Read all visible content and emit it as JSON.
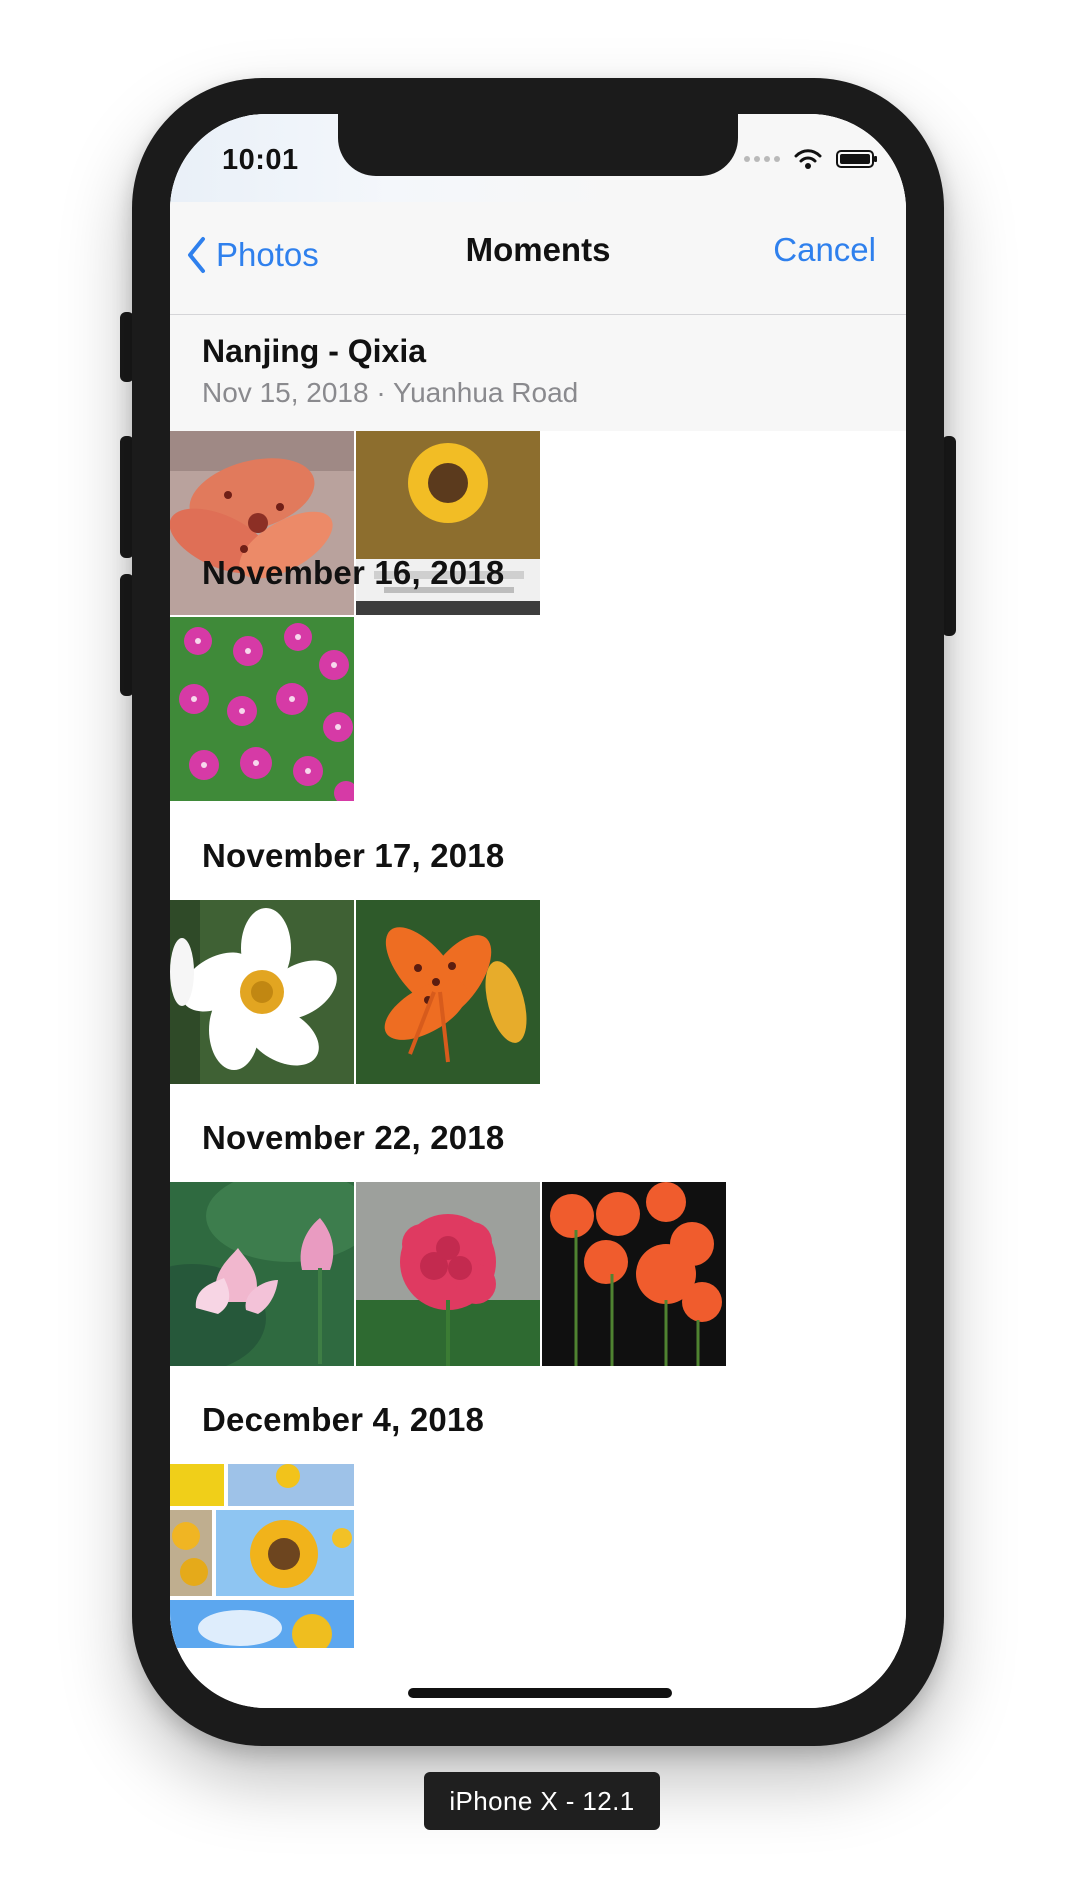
{
  "status_bar": {
    "time": "10:01",
    "icons": [
      "signal-dots-icon",
      "wifi-icon",
      "battery-icon"
    ]
  },
  "nav_bar": {
    "back_label": "Photos",
    "title": "Moments",
    "cancel_label": "Cancel",
    "accent_color": "#2F80ED"
  },
  "header": {
    "title": "Nanjing - Qixia",
    "subtitle": "Nov 15, 2018 · Yuanhua Road"
  },
  "sections": [
    {
      "date": "",
      "photos": [
        {
          "subject": "orange-tiger-lily-photo"
        },
        {
          "subject": "sunflower-screen-photo"
        }
      ]
    },
    {
      "date": "November 16, 2018",
      "photos": [
        {
          "subject": "pink-periwinkle-photo"
        }
      ]
    },
    {
      "date": "November 17, 2018",
      "photos": [
        {
          "subject": "narcissus-photo"
        },
        {
          "subject": "orange-lily-photo"
        }
      ]
    },
    {
      "date": "November 22, 2018",
      "photos": [
        {
          "subject": "lotus-photo"
        },
        {
          "subject": "carnation-photo"
        },
        {
          "subject": "poppies-photo"
        }
      ]
    },
    {
      "date": "December 4, 2018",
      "photos": [
        {
          "subject": "sunflower-collage-photo"
        }
      ]
    }
  ],
  "device_label": "iPhone X - 12.1"
}
